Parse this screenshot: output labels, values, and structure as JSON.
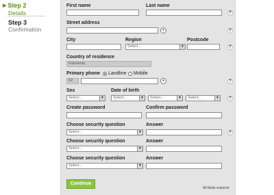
{
  "steps": [
    {
      "title": "Step 2",
      "subtitle": "Details"
    },
    {
      "title": "Step 3",
      "subtitle": "Confirmation"
    }
  ],
  "form": {
    "first_name_label": "First name",
    "last_name_label": "Last name",
    "street_label": "Street address",
    "city_label": "City",
    "region_label": "Region",
    "region_value": "Select...",
    "postcode_label": "Postcode",
    "country_label": "Country of residence",
    "country_value": "Indonesia",
    "phone_label": "Primary phone",
    "landline_label": "Landline",
    "mobile_label": "Mobile",
    "phone_code": "62",
    "sex_label": "Sex",
    "dob_label": "Date of birth",
    "select_placeholder": "Select...",
    "create_password_label": "Create password",
    "confirm_password_label": "Confirm password",
    "security_question_label": "Choose security question",
    "answer_label": "Answer",
    "continue_label": "Continue",
    "required_note": "All fields required"
  },
  "icons": {
    "add": "+",
    "help": "?",
    "dropdown": "▼",
    "step_arrow": "▶"
  },
  "colors": {
    "accent": "#8cc63f",
    "step_active": "#5a8f1d",
    "panel_bg": "#e4e4e4"
  }
}
